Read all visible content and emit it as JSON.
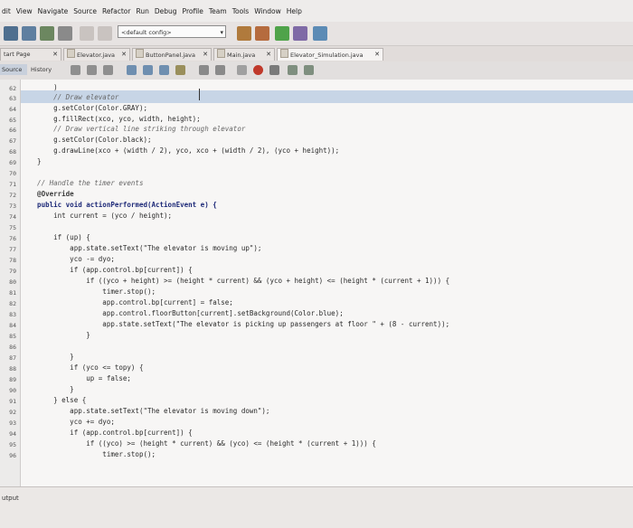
{
  "menu": [
    "dit",
    "View",
    "Navigate",
    "Source",
    "Refactor",
    "Run",
    "Debug",
    "Profile",
    "Team",
    "Tools",
    "Window",
    "Help"
  ],
  "toolbar": {
    "config": "<default config>"
  },
  "tabs": [
    {
      "label": "tart Page"
    },
    {
      "label": "Elevator.java"
    },
    {
      "label": "ButtonPanel.java"
    },
    {
      "label": "Main.java"
    },
    {
      "label": "Elevator_Simulation.java"
    }
  ],
  "editor_toolbar": {
    "source": "Source",
    "history": "History"
  },
  "line_numbers": [
    "62",
    "63",
    "64",
    "65",
    "66",
    "67",
    "68",
    "69",
    "70",
    "71",
    "72",
    "73",
    "74",
    "75",
    "76",
    "77",
    "78",
    "79",
    "80",
    "81",
    "82",
    "83",
    "84",
    "85",
    "86",
    "87",
    "88",
    "89",
    "90",
    "91",
    "92",
    "93",
    "94",
    "95",
    "96"
  ],
  "code_lines": [
    "        )",
    "        // Draw elevator",
    "        g.setColor(Color.GRAY);",
    "        g.fillRect(xco, yco, width, height);",
    "        // Draw vertical line striking through elevator",
    "        g.setColor(Color.black);",
    "        g.drawLine(xco + (width / 2), yco, xco + (width / 2), (yco + height));",
    "    }",
    "",
    "    // Handle the timer events",
    "    @Override",
    "    public void actionPerformed(ActionEvent e) {",
    "        int current = (yco / height);",
    "",
    "        if (up) {",
    "            app.state.setText(\"The elevator is moving up\");",
    "            yco -= dyo;",
    "            if (app.control.bp[current]) {",
    "                if ((yco + height) >= (height * current) && (yco + height) <= (height * (current + 1))) {",
    "                    timer.stop();",
    "                    app.control.bp[current] = false;",
    "                    app.control.floorButton[current].setBackground(Color.blue);",
    "                    app.state.setText(\"The elevator is picking up passengers at floor \" + (8 - current));",
    "                }",
    "",
    "            }",
    "            if (yco <= topy) {",
    "                up = false;",
    "            }",
    "        } else {",
    "            app.state.setText(\"The elevator is moving down\");",
    "            yco += dyo;",
    "            if (app.control.bp[current]) {",
    "                if ((yco) >= (height * current) && (yco) <= (height * (current + 1))) {",
    "                    timer.stop();"
  ],
  "output": {
    "label": "utput"
  },
  "colors": {
    "highlight": "#c7d5e6",
    "editor_bg": "#f7f6f5",
    "keyword": "#1e2a78"
  }
}
